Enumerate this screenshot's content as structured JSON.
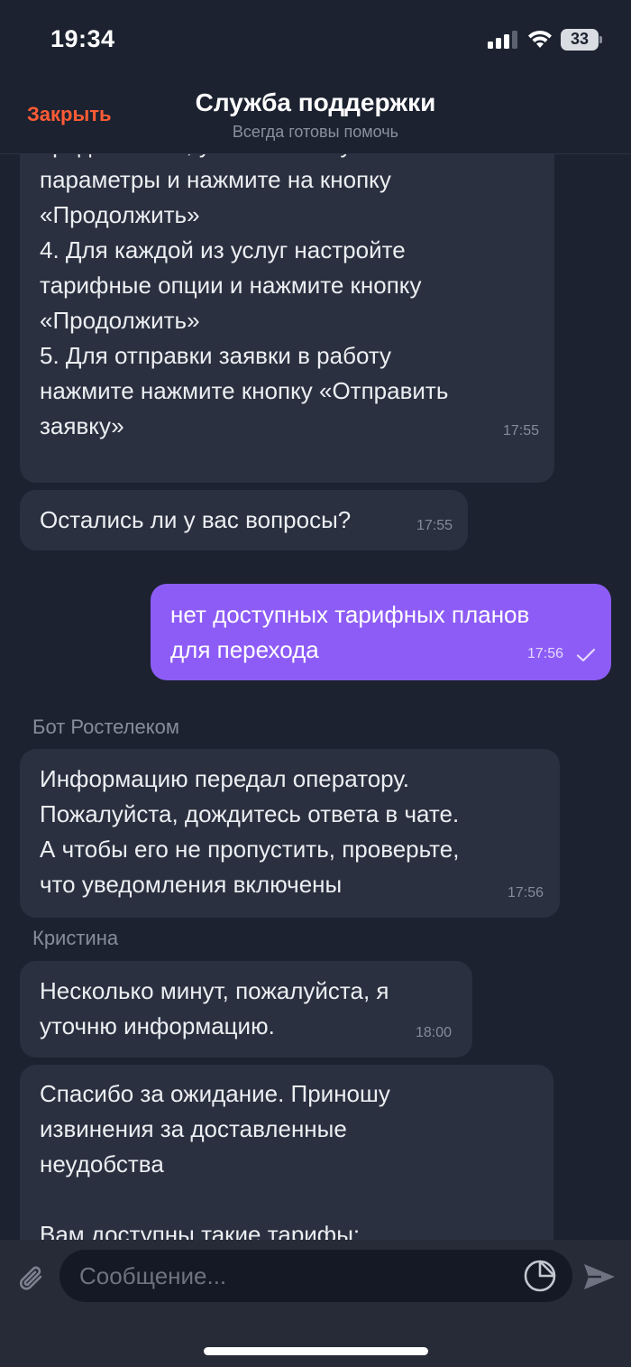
{
  "status": {
    "time": "19:34",
    "battery": "33"
  },
  "header": {
    "close_label": "Закрыть",
    "title": "Служба поддержки",
    "subtitle": "Всегда готовы помочь"
  },
  "messages": [
    {
      "direction": "in",
      "text": "предложение, установите нужные вам\nпараметры и нажмите на кнопку\n«Продолжить»\n4. Для каждой из услуг настройте\nтарифные опции и нажмите кнопку\n«Продолжить»\n5. Для отправки заявки в работу\nнажмите нажмите кнопку «Отправить\nзаявку»",
      "time": "17:55"
    },
    {
      "direction": "in",
      "text": "Остались ли у вас вопросы?",
      "time": "17:55"
    },
    {
      "direction": "out",
      "text": "нет доступных тарифных планов\nдля перехода",
      "time": "17:56",
      "status_icon": "check-icon"
    },
    {
      "direction": "in",
      "sender": "Бот Ростелеком",
      "text": "Информацию передал оператору.\nПожалуйста, дождитесь ответа в чате.\nА чтобы его не пропустить, проверьте,\nчто уведомления включены",
      "time": "17:56"
    },
    {
      "direction": "in",
      "sender": "Кристина",
      "text": "Несколько минут, пожалуйста, я\nуточню информацию.",
      "time": "18:00"
    },
    {
      "direction": "in",
      "text": "Спасибо за ожидание. Приношу\nизвинения за доставленные\nнеудобства\n\nВам доступны такие тарифы:",
      "time": ""
    }
  ],
  "composer": {
    "placeholder": "Сообщение...",
    "icons": [
      "paperclip-icon",
      "sticker-icon",
      "send-icon"
    ]
  },
  "colors": {
    "background": "#1c2230",
    "incoming_bubble": "#2a303f",
    "outgoing_bubble": "#8d5cf6",
    "accent": "#ff5c35"
  }
}
